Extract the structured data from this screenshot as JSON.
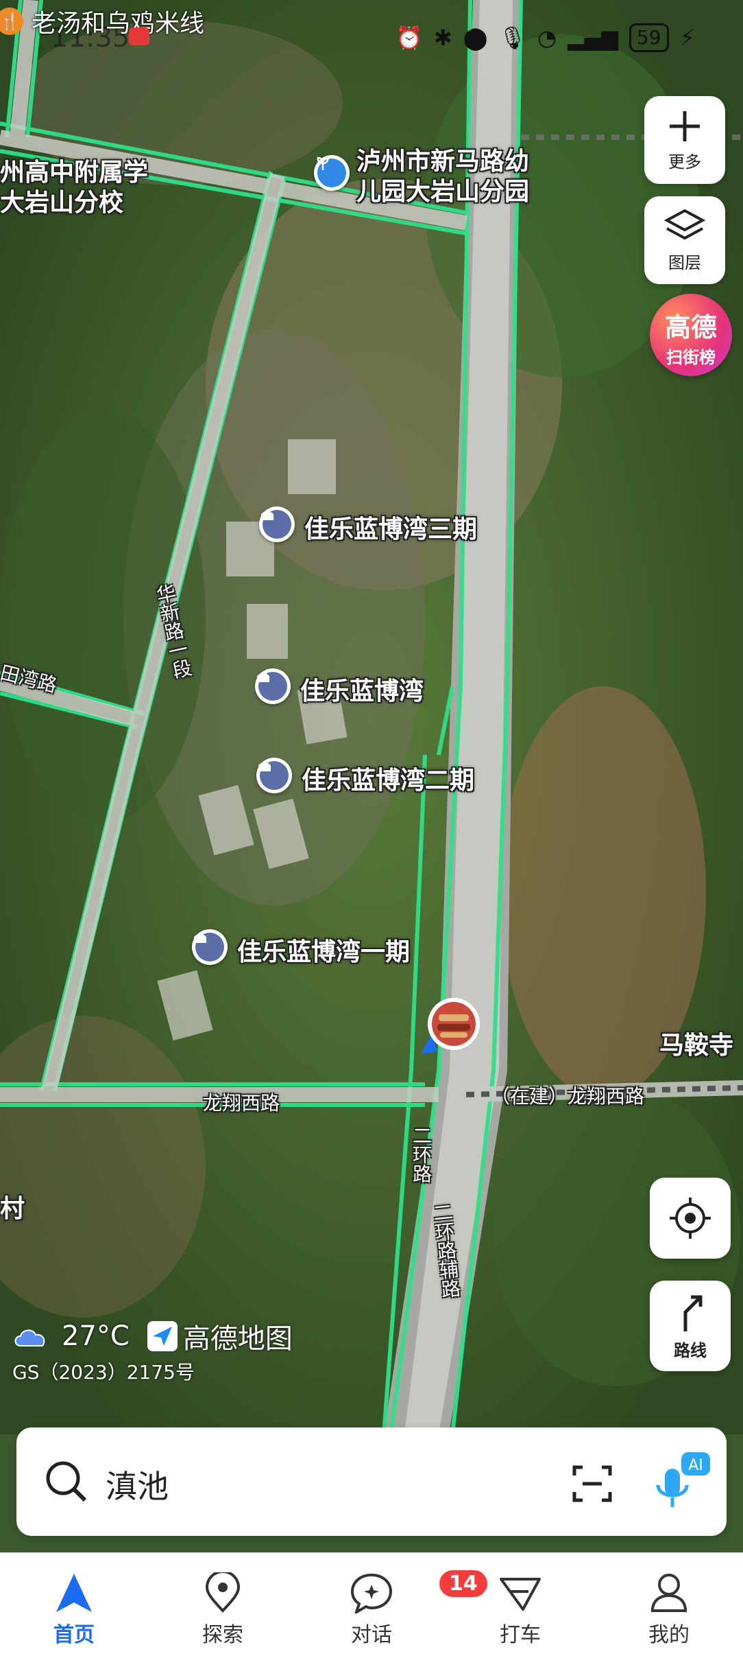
{
  "status_bar": {
    "time": "11:35",
    "notification": "老汤和乌鸡米线",
    "battery": "59"
  },
  "map": {
    "labels": {
      "school_left": "州高中附属学\n大岩山分校",
      "school_left_l1": "州高中附属学",
      "school_left_l2": "大岩山分校",
      "kindergarten_l1": "泸州市新马路幼",
      "kindergarten_l2": "儿园大岩山分园",
      "poi_phase3": "佳乐蓝博湾三期",
      "poi_main": "佳乐蓝博湾",
      "poi_phase2": "佳乐蓝博湾二期",
      "poi_phase1": "佳乐蓝博湾一期",
      "temple": "马鞍寺",
      "village": "村",
      "road_huaxin": "华新路一段",
      "road_tianwan": "田湾路",
      "road_longxiang": "龙翔西路",
      "road_longxiang_construction": "（在建）龙翔西路",
      "road_ring2": "二环路",
      "road_ring2_aux": "二环路辅路"
    },
    "buttons": {
      "more": "更多",
      "layers": "图层",
      "rank_line1": "高德",
      "rank_line2": "扫街榜",
      "route": "路线"
    },
    "weather": {
      "temp": "27°C",
      "brand": "高德地图",
      "license": "GS（2023）2175号"
    }
  },
  "search": {
    "value": "滇池"
  },
  "nav": {
    "items": [
      {
        "label": "首页"
      },
      {
        "label": "探索"
      },
      {
        "label": "对话",
        "badge": "14"
      },
      {
        "label": "打车"
      },
      {
        "label": "我的"
      }
    ]
  },
  "colors": {
    "accent": "#1c6cf2",
    "road_highlight": "#2fe08a",
    "badge": "#f43c3c"
  }
}
